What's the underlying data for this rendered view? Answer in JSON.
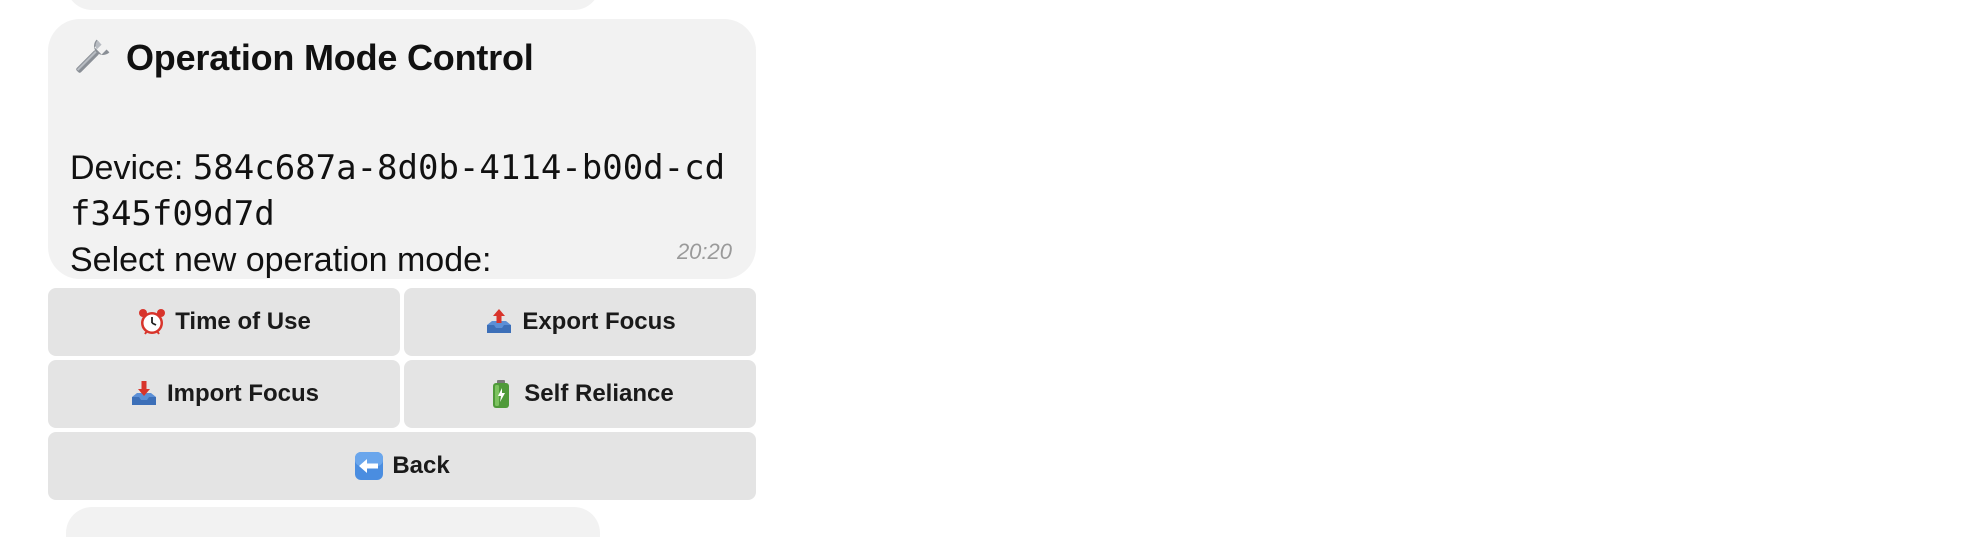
{
  "message": {
    "title": "Operation Mode Control",
    "title_icon": "wrench-icon",
    "device_label": "Device: ",
    "device_id": "584c687a-8d0b-4114-b00d-cdf345f09d7d",
    "prompt": "Select new operation mode:",
    "time": "20:20"
  },
  "keyboard": {
    "time_of_use": {
      "label": "Time of Use",
      "icon": "alarm-clock-icon"
    },
    "export_focus": {
      "label": "Export Focus",
      "icon": "outbox-tray-icon"
    },
    "import_focus": {
      "label": "Import Focus",
      "icon": "inbox-tray-icon"
    },
    "self_reliance": {
      "label": "Self Reliance",
      "icon": "battery-icon"
    },
    "back": {
      "label": "Back",
      "icon": "back-arrow-icon"
    }
  },
  "colors": {
    "bubble_bg": "#f2f2f2",
    "button_bg": "#e4e4e4",
    "timestamp": "#9a9a9a"
  }
}
